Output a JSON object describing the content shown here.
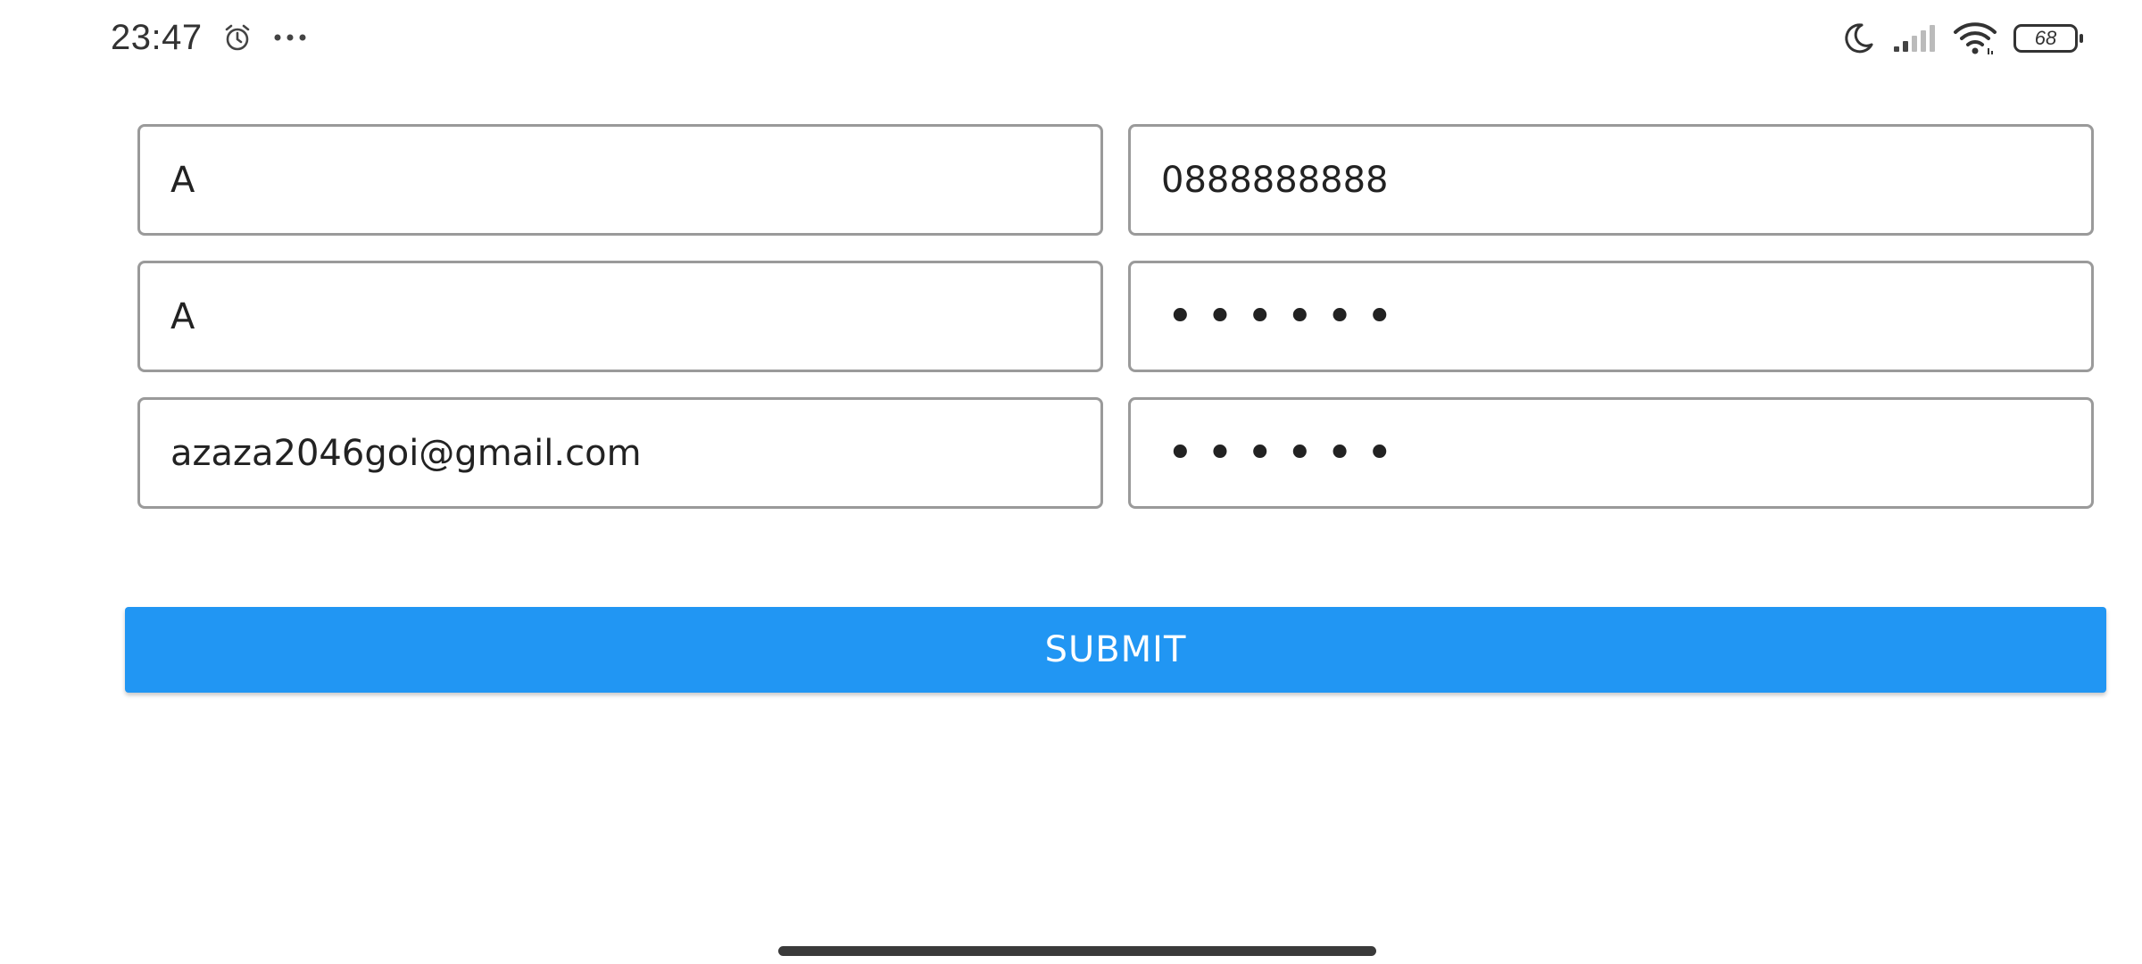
{
  "status_bar": {
    "time": "23:47",
    "left_icons": [
      "alarm-icon",
      "more-dots-icon"
    ],
    "right_icons": [
      "moon-icon",
      "signal-icon",
      "wifi-icon",
      "battery-icon"
    ],
    "battery_level": "68"
  },
  "form": {
    "fields": [
      {
        "name": "first-name-field",
        "value": "A"
      },
      {
        "name": "phone-field",
        "value": "0888888888"
      },
      {
        "name": "last-name-field",
        "value": "A"
      },
      {
        "name": "password-field",
        "value": "••••••"
      },
      {
        "name": "email-field",
        "value": "azaza2046goi@gmail.com"
      },
      {
        "name": "confirm-password-field",
        "value": "••••••"
      }
    ],
    "submit_label": "SUBMIT"
  },
  "colors": {
    "primary": "#2196f3",
    "field_border": "#9a9a9a",
    "background": "#ffffff"
  }
}
